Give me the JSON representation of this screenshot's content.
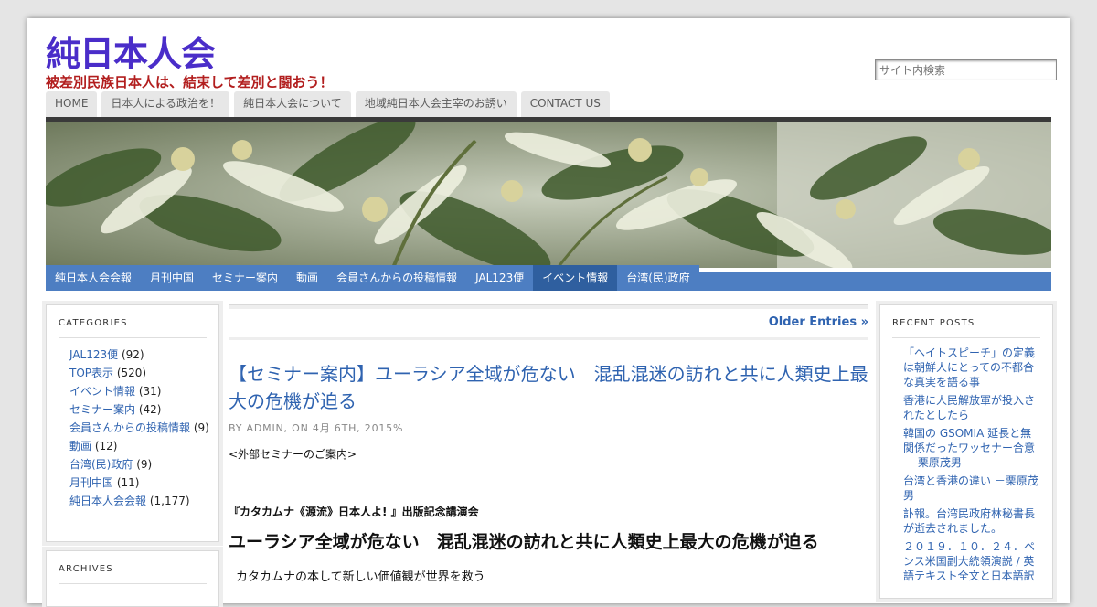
{
  "site": {
    "title": "純日本人会",
    "tagline": "被差別民族日本人は、結束して差別と闘おう！",
    "search_placeholder": "サイト内検索"
  },
  "top_nav": [
    {
      "label": "HOME"
    },
    {
      "label": "日本人による政治を！"
    },
    {
      "label": "純日本人会について"
    },
    {
      "label": "地域純日本人会主宰のお誘い"
    },
    {
      "label": "CONTACT US"
    }
  ],
  "category_nav": [
    {
      "label": "純日本人会会報",
      "active": false
    },
    {
      "label": "月刊中国",
      "active": false
    },
    {
      "label": "セミナー案内",
      "active": false
    },
    {
      "label": "動画",
      "active": false
    },
    {
      "label": "会員さんからの投稿情報",
      "active": false
    },
    {
      "label": "JAL123便",
      "active": false
    },
    {
      "label": "イベント情報",
      "active": true
    },
    {
      "label": "台湾(民)政府",
      "active": false
    }
  ],
  "categories_widget": {
    "title": "CATEGORIES",
    "items": [
      {
        "name": "JAL123便",
        "count": "(92)"
      },
      {
        "name": "TOP表示",
        "count": "(520)"
      },
      {
        "name": "イベント情報",
        "count": "(31)"
      },
      {
        "name": "セミナー案内",
        "count": "(42)"
      },
      {
        "name": "会員さんからの投稿情報",
        "count": "(9)"
      },
      {
        "name": "動画",
        "count": "(12)"
      },
      {
        "name": "台湾(民)政府",
        "count": "(9)"
      },
      {
        "name": "月刊中国",
        "count": "(11)"
      },
      {
        "name": "純日本人会会報",
        "count": "(1,177)"
      }
    ]
  },
  "archives_widget": {
    "title": "ARCHIVES"
  },
  "recent_posts_widget": {
    "title": "RECENT POSTS",
    "items": [
      "「ヘイトスピーチ」の定義は朝鮮人にとっての不都合な真実を語る事",
      "香港に人民解放軍が投入されたとしたら",
      "韓国の GSOMIA 延長と無関係だったワッセナー合意　　　— 栗原茂男",
      "台湾と香港の違い －栗原茂男",
      "訃報。台湾民政府林秘書長が逝去されました。",
      "２０１９．１０．２４．ペンス米国副大統領演説 / 英語テキスト全文と日本語訳"
    ]
  },
  "main": {
    "older_entries": "Older Entries »",
    "post": {
      "title": "【セミナー案内】ユーラシア全域が危ない　混乱混迷の訪れと共に人類史上最大の危機が迫る",
      "byline": "BY ADMIN, ON 4月 6TH, 2015%",
      "intro": "<外部セミナーのご案内>",
      "event_name": "『カタカムナ《源流》日本人よ! 』出版記念講演会",
      "heading": "ユーラシア全域が危ない　混乱混迷の訪れと共に人類史上最大の危機が迫る",
      "tail": "カタカムナの本して新しい価値観が世界を救う"
    }
  },
  "colors": {
    "title": "#4a2dc9",
    "tagline": "#b21e1e",
    "link": "#2f63b0",
    "category_nav_bg": "#4d7ec2",
    "category_nav_active": "#2f5f9f"
  }
}
